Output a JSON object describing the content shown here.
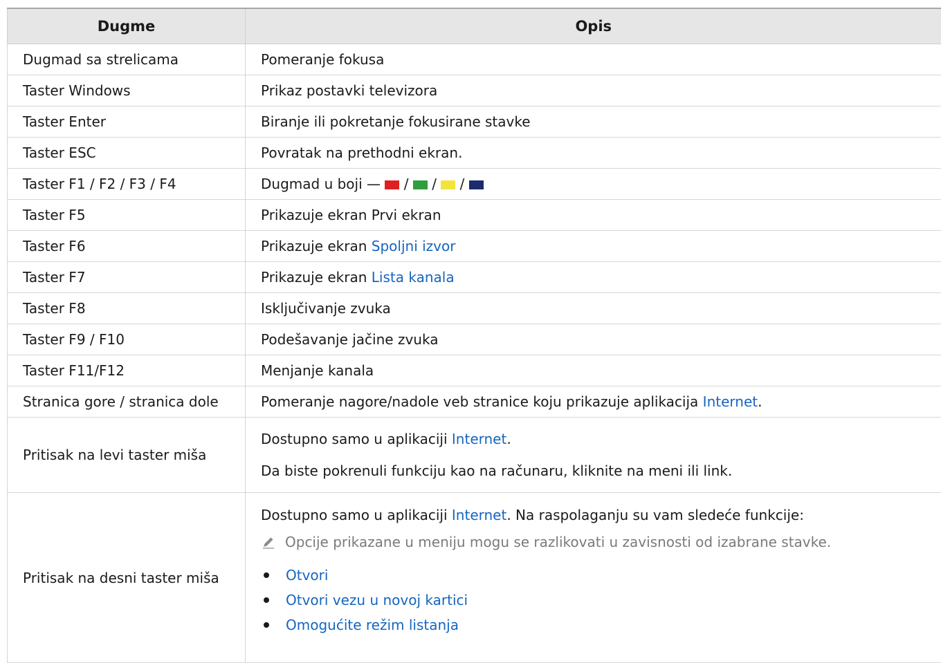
{
  "headers": {
    "button": "Dugme",
    "description": "Opis"
  },
  "rows": [
    {
      "key": "Dugmad sa strelicama",
      "desc": "Pomeranje fokusa"
    },
    {
      "key": "Taster Windows",
      "desc": "Prikaz postavki televizora"
    },
    {
      "key": "Taster Enter",
      "desc": "Biranje ili pokretanje fokusirane stavke"
    },
    {
      "key": "Taster ESC",
      "desc": "Povratak na prethodni ekran."
    },
    {
      "key": "Taster F1 / F2 / F3 / F4",
      "desc_prefix": "Dugmad u boji —",
      "separator": "/",
      "colors": [
        "#e02020",
        "#2e9e3e",
        "#f2e43a",
        "#1c2a6e"
      ]
    },
    {
      "key": "Taster F5",
      "desc": "Prikazuje ekran Prvi ekran"
    },
    {
      "key": "Taster F6",
      "desc_prefix": "Prikazuje ekran",
      "desc_link": "Spoljni izvor"
    },
    {
      "key": "Taster F7",
      "desc_prefix": "Prikazuje ekran",
      "desc_link": "Lista kanala"
    },
    {
      "key": "Taster F8",
      "desc": "Isključivanje zvuka"
    },
    {
      "key": "Taster F9 / F10",
      "desc": "Podešavanje jačine zvuka"
    },
    {
      "key": "Taster F11/F12",
      "desc": "Menjanje kanala"
    },
    {
      "key": "Stranica gore / stranica dole",
      "desc_prefix": "Pomeranje nagore/nadole veb stranice koju prikazuje aplikacija",
      "desc_link": "Internet",
      "desc_suffix": "."
    },
    {
      "key": "Pritisak na levi taster miša",
      "line1_prefix": "Dostupno samo u aplikaciji",
      "line1_link": "Internet",
      "line1_suffix": ".",
      "line2": "Da biste pokrenuli funkciju kao na računaru, kliknite na meni ili link."
    },
    {
      "key": "Pritisak na desni taster miša",
      "line1_prefix": "Dostupno samo u aplikaciji",
      "line1_link": "Internet",
      "line1_suffix": ". Na raspolaganju su vam sledeće funkcije:",
      "note": "Opcije prikazane u meniju mogu se razlikovati u zavisnosti od izabrane stavke.",
      "note_icon": "pencil-icon",
      "items": [
        "Otvori",
        "Otvori vezu u novoj kartici",
        "Omogućite režim listanja"
      ]
    }
  ],
  "colors": {
    "link": "#1565c0",
    "header_bg": "#e6e6e6",
    "note_text": "#7a7a7a"
  }
}
